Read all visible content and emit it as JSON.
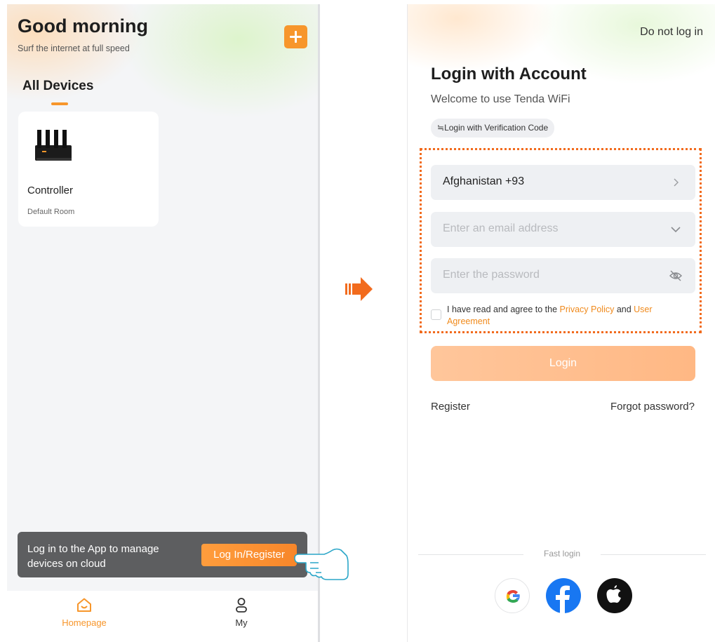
{
  "home": {
    "greeting": "Good morning",
    "subtitle": "Surf the internet at full speed",
    "section_title": "All Devices",
    "device": {
      "name": "Controller",
      "room": "Default Room"
    },
    "banner": {
      "text": "Log in to the App to manage devices on cloud",
      "button": "Log In/Register"
    },
    "tabs": [
      {
        "label": "Homepage",
        "icon": "home-icon",
        "active": true
      },
      {
        "label": "My",
        "icon": "person-icon",
        "active": false
      }
    ]
  },
  "login": {
    "skip": "Do not log in",
    "title": "Login with Account",
    "welcome": "Welcome to use Tenda WiFi",
    "verification_chip": "≒Login with Verification Code",
    "country": "Afghanistan +93",
    "email_placeholder": "Enter an email address",
    "password_placeholder": "Enter the password",
    "agree_prefix": "I have read and agree to the ",
    "privacy_policy": "Privacy Policy",
    "agree_and": " and ",
    "user_agreement": "User Agreement",
    "login_button": "Login",
    "register": "Register",
    "forgot": "Forgot password?",
    "fast_login": "Fast login",
    "social": [
      "google-icon",
      "facebook-icon",
      "apple-icon"
    ]
  },
  "colors": {
    "accent": "#f7962b",
    "highlight_border": "#f26b1d",
    "link": "#f08a1c",
    "login_button": "#ffc69b"
  }
}
